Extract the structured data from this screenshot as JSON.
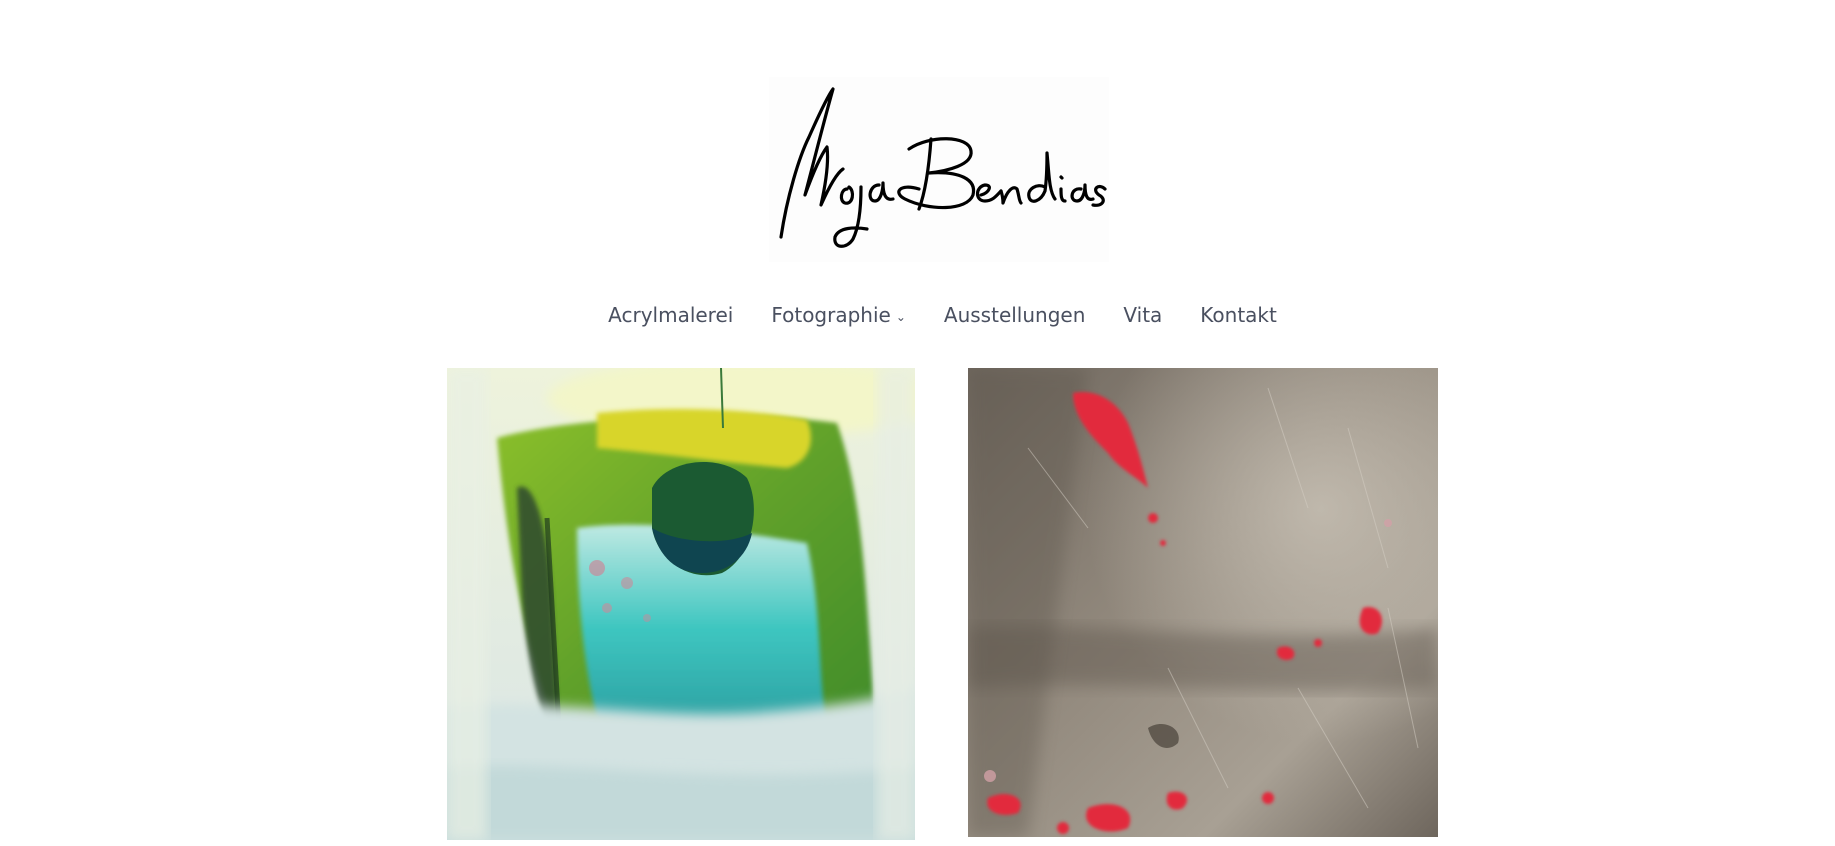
{
  "site": {
    "logo_text": "Moja Bendias"
  },
  "nav": {
    "items": [
      {
        "label": "Acrylmalerei",
        "has_submenu": false
      },
      {
        "label": "Fotographie",
        "has_submenu": true
      },
      {
        "label": "Ausstellungen",
        "has_submenu": false
      },
      {
        "label": "Vita",
        "has_submenu": false
      },
      {
        "label": "Kontakt",
        "has_submenu": false
      }
    ],
    "submenu_icon": "chevron-down-icon"
  },
  "gallery": {
    "tiles": [
      {
        "type": "abstract-acrylic-painting",
        "palette": [
          "#e9efe0",
          "#6aa321",
          "#1a6a3a",
          "#3cc6c0",
          "#c9d9d6"
        ]
      },
      {
        "type": "textured-concrete-photograph",
        "palette": [
          "#7d746a",
          "#a39a8e",
          "#e2293d",
          "#5a524a"
        ]
      }
    ]
  },
  "colors": {
    "nav_text": "#4a5060",
    "background": "#ffffff"
  }
}
